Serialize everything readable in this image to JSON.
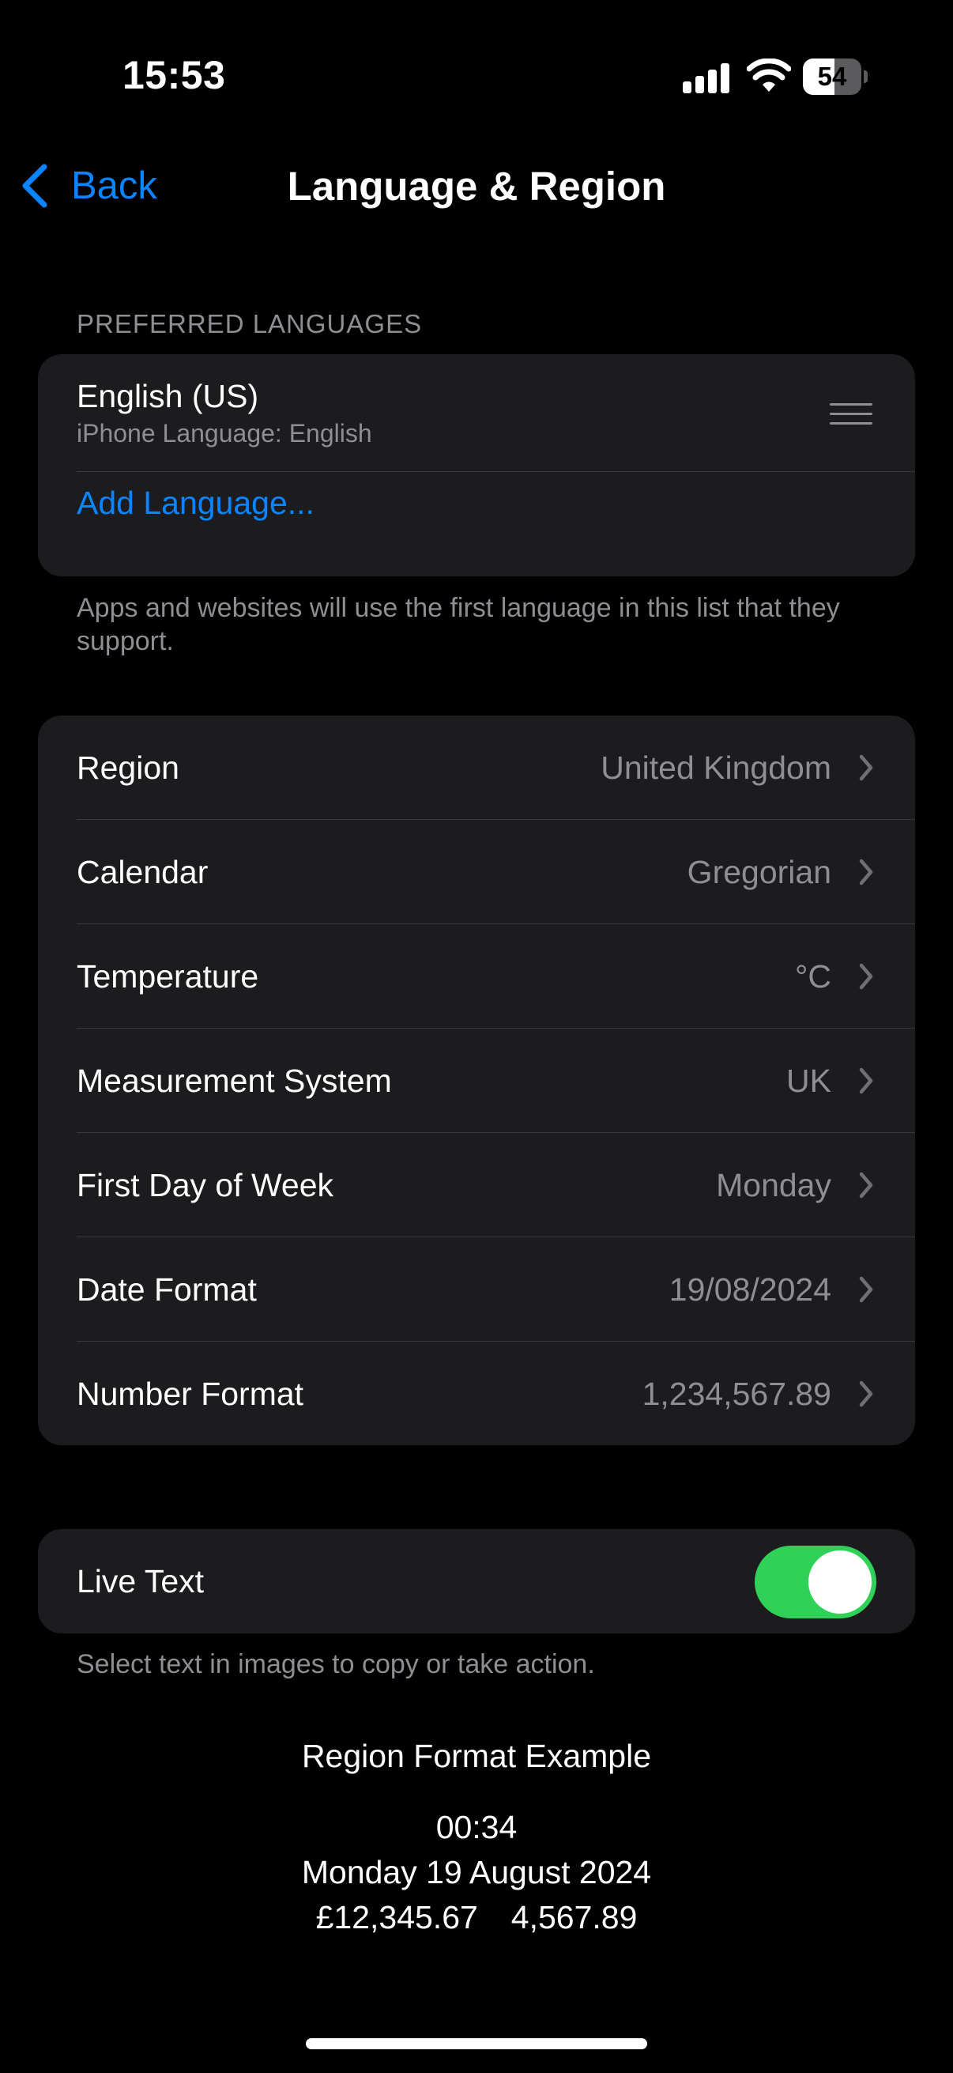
{
  "status_bar": {
    "time": "15:53",
    "battery": "54",
    "battery_level": 0.54
  },
  "nav": {
    "back_label": "Back",
    "title": "Language & Region"
  },
  "preferred_languages": {
    "header": "PREFERRED LANGUAGES",
    "languages": [
      {
        "name": "English (US)",
        "detail": "iPhone Language: English"
      }
    ],
    "add_label": "Add Language...",
    "footer": "Apps and websites will use the first language in this list that they support."
  },
  "settings": [
    {
      "label": "Region",
      "value": "United Kingdom"
    },
    {
      "label": "Calendar",
      "value": "Gregorian"
    },
    {
      "label": "Temperature",
      "value": "°C"
    },
    {
      "label": "Measurement System",
      "value": "UK"
    },
    {
      "label": "First Day of Week",
      "value": "Monday"
    },
    {
      "label": "Date Format",
      "value": "19/08/2024"
    },
    {
      "label": "Number Format",
      "value": "1,234,567.89"
    }
  ],
  "live_text": {
    "label": "Live Text",
    "enabled": true,
    "footer": "Select text in images to copy or take action."
  },
  "region_example": {
    "title": "Region Format Example",
    "time": "00:34",
    "date": "Monday 19 August 2024",
    "currency": "£12,345.67",
    "number": "4,567.89"
  },
  "colors": {
    "accent": "#0a84ff",
    "toggle_on": "#30d158",
    "secondary_text": "#8e8e93",
    "cell_background": "#1c1c1e"
  }
}
